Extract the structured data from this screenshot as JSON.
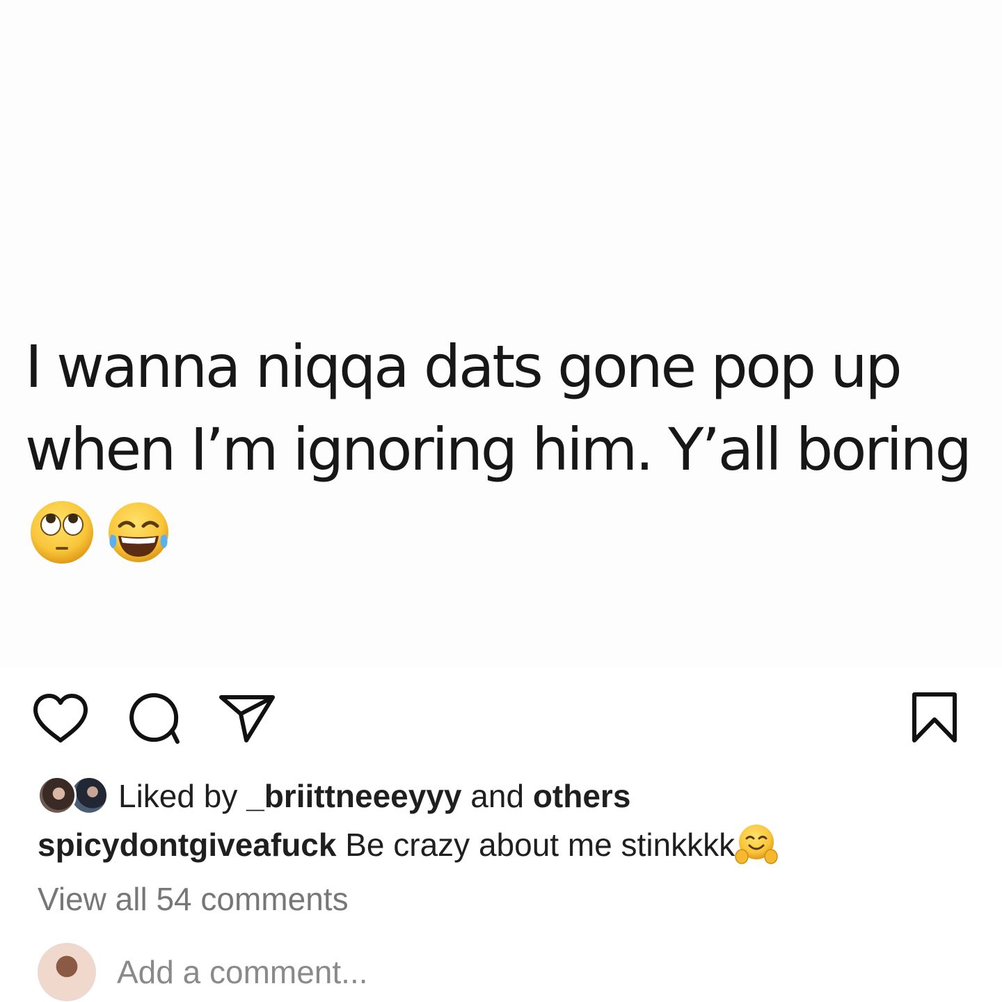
{
  "post": {
    "text_lines": [
      "I wanna niqqa dats gone pop up",
      "when I’m ignoring him. Y’all boring"
    ],
    "emojis": [
      "face-with-rolling-eyes",
      "face-with-tears-of-joy"
    ]
  },
  "actions": {
    "icons": [
      "heart-icon",
      "comment-icon",
      "paper-plane-icon",
      "bookmark-icon"
    ]
  },
  "likes": {
    "prefix": "Liked by ",
    "user": "_briittneeeyyy",
    "middle": " and ",
    "others": "others"
  },
  "caption": {
    "username": "spicydontgiveafuck",
    "text": " Be crazy about me stinkkkk",
    "emoji": "hugging-face"
  },
  "comments": {
    "view_all": "View all 54 comments"
  },
  "add_comment": {
    "placeholder": "Add a comment..."
  }
}
